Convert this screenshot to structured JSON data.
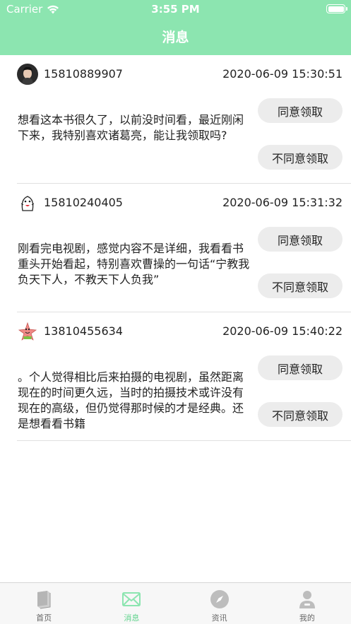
{
  "status_bar": {
    "carrier": "Carrier",
    "time": "3:55 PM"
  },
  "header": {
    "title": "消息"
  },
  "messages": [
    {
      "phone": "15810889907",
      "timestamp": "2020-06-09 15:30:51",
      "text": "想看这本书很久了，以前没时间看，最近刚闲下来，我特别喜欢诸葛亮，能让我领取吗?",
      "agree_label": "同意领取",
      "disagree_label": "不同意领取"
    },
    {
      "phone": "15810240405",
      "timestamp": "2020-06-09 15:31:32",
      "text": "刚看完电视剧，感觉内容不是详细，我看看书重头开始看起，特别喜欢曹操的一句话“宁教我负天下人，不教天下人负我”",
      "agree_label": "同意领取",
      "disagree_label": "不同意领取"
    },
    {
      "phone": "13810455634",
      "timestamp": "2020-06-09 15:40:22",
      "text": "。个人觉得相比后来拍摄的电视剧，虽然距离现在的时间更久远，当时的拍摄技术或许没有现在的高级，但仍觉得那时候的才是经典。还是想看看书籍",
      "agree_label": "同意领取",
      "disagree_label": "不同意领取"
    }
  ],
  "tab_bar": {
    "tabs": [
      {
        "label": "首页",
        "icon": "book-icon"
      },
      {
        "label": "消息",
        "icon": "mail-icon",
        "active": true
      },
      {
        "label": "资讯",
        "icon": "compass-icon"
      },
      {
        "label": "我的",
        "icon": "person-icon"
      }
    ]
  },
  "colors": {
    "accent": "#8ce5b0",
    "active_tab": "#5fd38c",
    "button_bg": "#ececec"
  }
}
